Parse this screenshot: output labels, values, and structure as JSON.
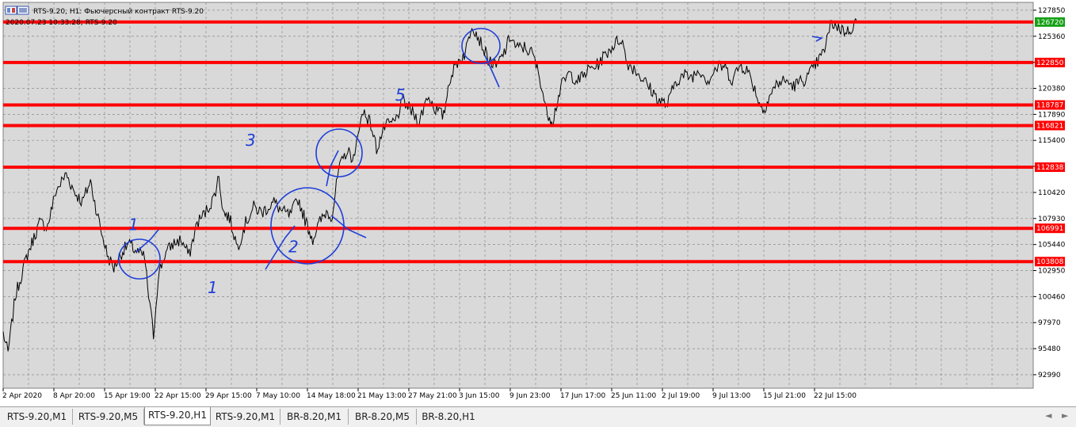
{
  "window": {
    "title": "RTS-9.20, H1:  Фьючерсный контракт RTS-9.20",
    "info_line": "2020.07.23 10:33:28; RTS-9.20"
  },
  "chart_data": {
    "type": "line",
    "symbol": "RTS-9.20",
    "timeframe": "H1",
    "ylim": [
      91700,
      128600
    ],
    "y_ticks": [
      127850,
      125360,
      122870,
      120380,
      117890,
      115400,
      112910,
      110420,
      107930,
      105440,
      102950,
      100460,
      97970,
      95480,
      92990
    ],
    "x_ticks": [
      "2 Apr 2020",
      "8 Apr 20:00",
      "15 Apr 19:00",
      "22 Apr 15:00",
      "29 Apr 15:00",
      "7 May 10:00",
      "14 May 18:00",
      "21 May 13:00",
      "27 May 21:00",
      "3 Jun 15:00",
      "9 Jun 23:00",
      "17 Jun 17:00",
      "25 Jun 11:00",
      "2 Jul 19:00",
      "9 Jul 13:00",
      "15 Jul 21:00",
      "22 Jul 15:00"
    ],
    "grid": true,
    "current_price": "126720",
    "current_price_color": "#16a016",
    "level_color": "#ff0000",
    "levels": [
      {
        "value": 126720,
        "label": "126720"
      },
      {
        "value": 122850,
        "label": "122850"
      },
      {
        "value": 118787,
        "label": "118787"
      },
      {
        "value": 116821,
        "label": "116821"
      },
      {
        "value": 112838,
        "label": "112838"
      },
      {
        "value": 106991,
        "label": "106991"
      },
      {
        "value": 103808,
        "label": "103808"
      }
    ],
    "price_path": [
      [
        0,
        97000
      ],
      [
        0.006,
        95000
      ],
      [
        0.015,
        100500
      ],
      [
        0.03,
        104500
      ],
      [
        0.045,
        107500
      ],
      [
        0.055,
        107200
      ],
      [
        0.065,
        110500
      ],
      [
        0.078,
        112200
      ],
      [
        0.088,
        110500
      ],
      [
        0.098,
        109500
      ],
      [
        0.108,
        111500
      ],
      [
        0.116,
        108500
      ],
      [
        0.122,
        106500
      ],
      [
        0.13,
        104200
      ],
      [
        0.137,
        103200
      ],
      [
        0.145,
        104500
      ],
      [
        0.155,
        105500
      ],
      [
        0.165,
        104800
      ],
      [
        0.175,
        104200
      ],
      [
        0.18,
        100500
      ],
      [
        0.186,
        96800
      ],
      [
        0.192,
        102500
      ],
      [
        0.2,
        104500
      ],
      [
        0.21,
        105500
      ],
      [
        0.22,
        105900
      ],
      [
        0.23,
        104400
      ],
      [
        0.24,
        107500
      ],
      [
        0.25,
        108500
      ],
      [
        0.26,
        109800
      ],
      [
        0.267,
        112000
      ],
      [
        0.272,
        108600
      ],
      [
        0.28,
        108000
      ],
      [
        0.29,
        105200
      ],
      [
        0.3,
        107500
      ],
      [
        0.31,
        109000
      ],
      [
        0.32,
        108500
      ],
      [
        0.335,
        109500
      ],
      [
        0.345,
        108600
      ],
      [
        0.355,
        108200
      ],
      [
        0.365,
        109800
      ],
      [
        0.375,
        107500
      ],
      [
        0.383,
        106000
      ],
      [
        0.392,
        107600
      ],
      [
        0.4,
        108600
      ],
      [
        0.407,
        108200
      ],
      [
        0.415,
        112500
      ],
      [
        0.425,
        114400
      ],
      [
        0.435,
        113600
      ],
      [
        0.44,
        116800
      ],
      [
        0.447,
        118200
      ],
      [
        0.455,
        116900
      ],
      [
        0.462,
        114600
      ],
      [
        0.472,
        116700
      ],
      [
        0.485,
        117200
      ],
      [
        0.495,
        119200
      ],
      [
        0.505,
        118200
      ],
      [
        0.515,
        117200
      ],
      [
        0.525,
        119700
      ],
      [
        0.535,
        118400
      ],
      [
        0.545,
        117700
      ],
      [
        0.552,
        121200
      ],
      [
        0.562,
        122900
      ],
      [
        0.572,
        123800
      ],
      [
        0.58,
        126600
      ],
      [
        0.588,
        125300
      ],
      [
        0.6,
        123200
      ],
      [
        0.61,
        122400
      ],
      [
        0.62,
        123800
      ],
      [
        0.628,
        125400
      ],
      [
        0.635,
        124200
      ],
      [
        0.645,
        124300
      ],
      [
        0.655,
        123700
      ],
      [
        0.665,
        121100
      ],
      [
        0.672,
        118200
      ],
      [
        0.68,
        117300
      ],
      [
        0.69,
        120500
      ],
      [
        0.7,
        121800
      ],
      [
        0.712,
        121100
      ],
      [
        0.725,
        122200
      ],
      [
        0.735,
        122600
      ],
      [
        0.745,
        123600
      ],
      [
        0.755,
        124500
      ],
      [
        0.765,
        125200
      ],
      [
        0.772,
        122800
      ],
      [
        0.782,
        122200
      ],
      [
        0.792,
        121200
      ],
      [
        0.802,
        120200
      ],
      [
        0.812,
        119200
      ],
      [
        0.822,
        118800
      ],
      [
        0.832,
        121100
      ],
      [
        0.842,
        121600
      ],
      [
        0.852,
        121500
      ],
      [
        0.862,
        122200
      ],
      [
        0.872,
        121100
      ],
      [
        0.882,
        122300
      ],
      [
        0.892,
        122500
      ],
      [
        0.902,
        121200
      ],
      [
        0.912,
        122600
      ],
      [
        0.92,
        122200
      ],
      [
        0.927,
        121000
      ],
      [
        0.933,
        119600
      ],
      [
        0.94,
        118200
      ],
      [
        0.948,
        119600
      ],
      [
        0.958,
        120900
      ],
      [
        0.968,
        121100
      ],
      [
        0.978,
        120600
      ],
      [
        0.988,
        121100
      ],
      [
        0.995,
        121400
      ],
      [
        1.005,
        122600
      ],
      [
        1.015,
        123800
      ],
      [
        1.025,
        126700
      ],
      [
        1.035,
        126100
      ],
      [
        1.045,
        125800
      ],
      [
        1.05,
        126200
      ],
      [
        1.056,
        126900
      ]
    ],
    "annotations": [
      {
        "text": "1",
        "data_x": 0.155,
        "value": 106800
      },
      {
        "text": "1",
        "data_x": 0.253,
        "value": 100800
      },
      {
        "text": "2",
        "data_x": 0.353,
        "value": 104700
      },
      {
        "text": "3",
        "data_x": 0.3,
        "value": 114900
      },
      {
        "text": "5",
        "data_x": 0.485,
        "value": 119200
      }
    ]
  },
  "tabs": [
    {
      "label": "RTS-9.20,M1",
      "active": false
    },
    {
      "label": "RTS-9.20,M5",
      "active": false
    },
    {
      "label": "RTS-9.20,H1",
      "active": true
    },
    {
      "label": "RTS-9.20,M1",
      "active": false
    },
    {
      "label": "BR-8.20,M1",
      "active": false
    },
    {
      "label": "BR-8.20,M5",
      "active": false
    },
    {
      "label": "BR-8.20,H1",
      "active": false
    }
  ],
  "nav": {
    "left": "◄",
    "right": "►"
  },
  "icons": [
    "chart-window-icon"
  ]
}
